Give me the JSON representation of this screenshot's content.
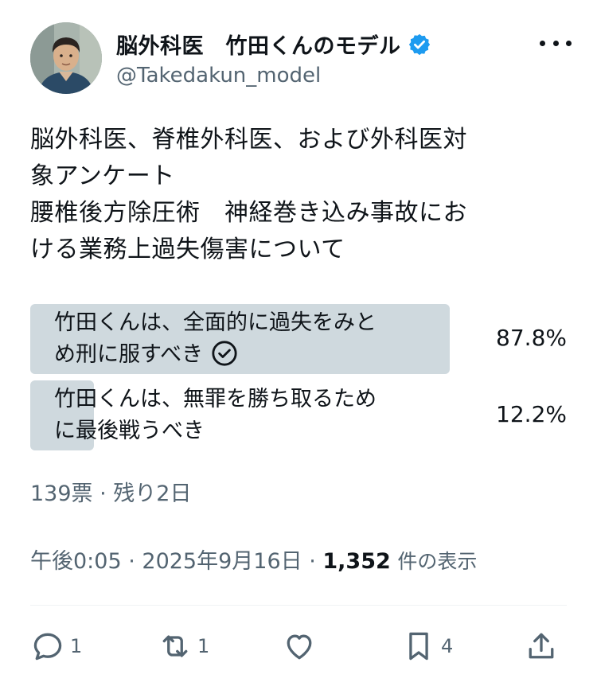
{
  "author": {
    "display_name": "脳外科医　竹田くんのモデル",
    "handle": "@Takedakun_model",
    "verified": true
  },
  "tweet": {
    "text_lines": [
      "脳外科医、脊椎外科医、および外科医対",
      "象アンケート",
      "腰椎後方除圧術　神経巻き込み事故にお",
      "ける業務上過失傷害について"
    ]
  },
  "poll": {
    "options": [
      {
        "lines": [
          "竹田くんは、全面的に過失をみと",
          "め刑に服すべき"
        ],
        "percent": "87.8%",
        "share": 0.878,
        "selected": true
      },
      {
        "lines": [
          "竹田くんは、無罪を勝ち取るため",
          "に最後戦うべき"
        ],
        "percent": "12.2%",
        "share": 0.122,
        "selected": false
      }
    ],
    "meta": "139票 · 残り2日"
  },
  "meta": {
    "time": "午後0:05",
    "date": "2025年9月16日",
    "separator": " · ",
    "views": "1,352",
    "views_label": "件の表示"
  },
  "actions": {
    "reply_count": "1",
    "retweet_count": "1",
    "like_count": "",
    "bookmark_count": "4"
  },
  "colors": {
    "text": "#0f1419",
    "secondary": "#536471",
    "poll_bar": "#cfd9de",
    "verified": "#1d9bf0"
  }
}
